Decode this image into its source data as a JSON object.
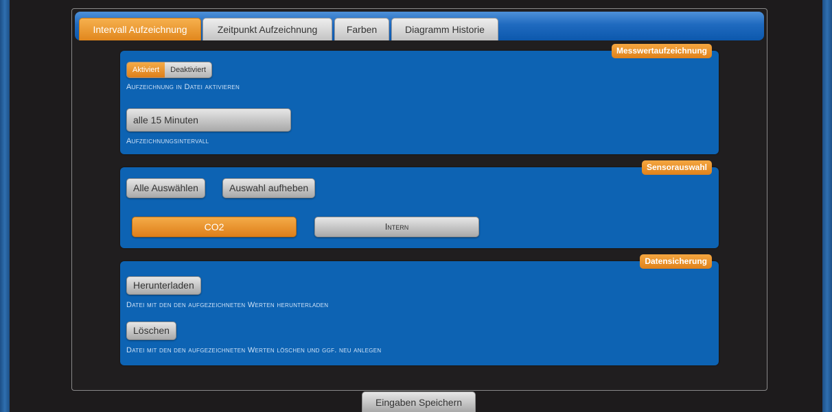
{
  "tabs": [
    {
      "label": "Intervall Aufzeichnung",
      "active": true
    },
    {
      "label": "Zeitpunkt Aufzeichnung",
      "active": false
    },
    {
      "label": "Farben",
      "active": false
    },
    {
      "label": "Diagramm Historie",
      "active": false
    }
  ],
  "measurement": {
    "title": "Messwertaufzeichnung",
    "toggle_on": "Aktiviert",
    "toggle_off": "Deaktiviert",
    "toggle_selected": "Aktiviert",
    "enable_caption": "Aufzeichnung in Datei aktivieren",
    "interval_value": "alle 15 Minuten",
    "interval_caption": "Aufzeichnungsintervall"
  },
  "sensors": {
    "title": "Sensorauswahl",
    "select_all": "Alle Auswählen",
    "deselect": "Auswahl aufheben",
    "items": [
      {
        "label": "CO2",
        "selected": true
      },
      {
        "label": "Intern",
        "selected": false
      }
    ]
  },
  "backup": {
    "title": "Datensicherung",
    "download_label": "Herunterladen",
    "download_caption": "Datei mit den den aufgezeichneten Werten herunterladen",
    "delete_label": "Löschen",
    "delete_caption": "Datei mit den den aufgezeichneten Werten löschen und ggf. neu anlegen"
  },
  "footer": {
    "save_label": "Eingaben Speichern"
  },
  "colors": {
    "accent": "#e1871d",
    "section_bg": "#0d63b3",
    "page_bg": "#1d1b1c"
  }
}
